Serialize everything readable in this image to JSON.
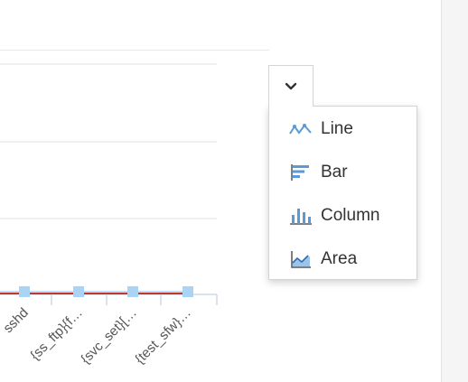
{
  "chart_data": {
    "type": "line",
    "categories": [
      "",
      "sshd",
      "{ss_ftp}{f…",
      "{svc_set}[…",
      "{test_sfw}…"
    ],
    "series": [
      {
        "values": [
          0,
          0,
          0,
          0,
          0
        ],
        "color": "#aad4f5"
      },
      {
        "values": [
          0,
          0,
          0,
          0,
          0
        ],
        "color": "#c0392b"
      }
    ],
    "grid": true
  },
  "switcher": {
    "button_icon": "chevron-down-icon",
    "items": [
      {
        "label": "Line",
        "icon": "line-chart-icon"
      },
      {
        "label": "Bar",
        "icon": "bar-chart-icon"
      },
      {
        "label": "Column",
        "icon": "column-chart-icon"
      },
      {
        "label": "Area",
        "icon": "area-chart-icon"
      }
    ]
  },
  "colors": {
    "accent": "#5b9bd5",
    "series_primary": "#aad4f5",
    "series_secondary": "#c0392b",
    "grid": "#e0e0e0"
  }
}
